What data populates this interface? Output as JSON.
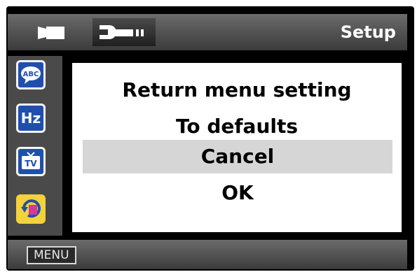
{
  "header": {
    "title": "Setup",
    "tabs": [
      {
        "name": "video",
        "icon": "video-camera-icon"
      },
      {
        "name": "setup",
        "icon": "wrench-icon",
        "selected": true
      }
    ]
  },
  "sidebar": {
    "items": [
      {
        "label": "ABC",
        "icon": "language-icon"
      },
      {
        "label": "Hz",
        "icon": "frequency-icon"
      },
      {
        "label": "TV",
        "icon": "tv-icon"
      },
      {
        "label": "",
        "icon": "default-reset-icon",
        "selected": true
      }
    ]
  },
  "dialog": {
    "message_line1": "Return menu setting",
    "message_line2": "To defaults",
    "options": [
      {
        "label": "Cancel",
        "selected": true
      },
      {
        "label": "OK",
        "selected": false
      }
    ]
  },
  "footer": {
    "menu_label": "MENU"
  },
  "colors": {
    "bar_top": "#6b6b6b",
    "bar_bottom": "#3b3b3b",
    "sidebar_bg": "#4a4a4a",
    "icon_blue": "#1e4fae",
    "selected_yellow": "#f3d23a",
    "option_highlight": "#d6d6d6"
  }
}
